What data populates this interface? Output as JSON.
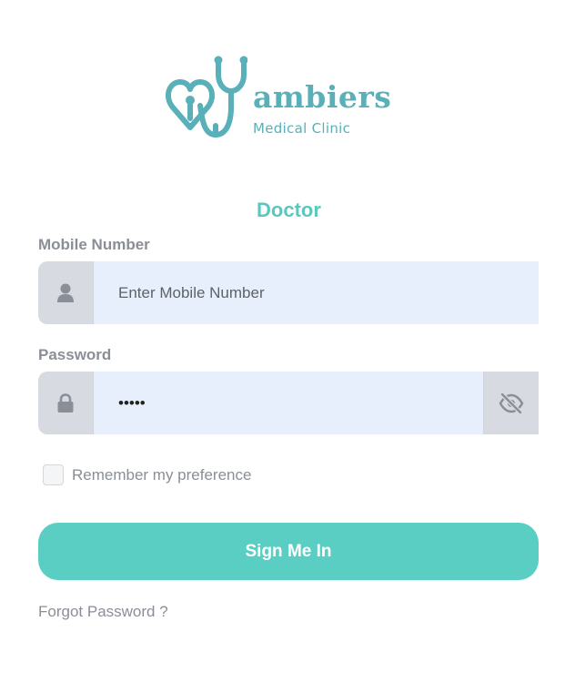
{
  "brand": {
    "name": "ambiers",
    "subtitle": "Medical Clinic",
    "color": "#5ab0b8"
  },
  "role_title": "Doctor",
  "mobile": {
    "label": "Mobile Number",
    "placeholder": "Enter Mobile Number",
    "value": "",
    "icon": "user-icon"
  },
  "password": {
    "label": "Password",
    "value": "•••••",
    "icon": "lock-icon",
    "toggle_icon": "eye-slash-icon"
  },
  "remember": {
    "label": "Remember my preference",
    "checked": false
  },
  "signin_label": "Sign Me In",
  "forgot_label": "Forgot Password ?",
  "colors": {
    "accent": "#5bcec3",
    "input_bg": "#e8effc",
    "addon_bg": "#d7dae1",
    "label_text": "#8a8e96"
  }
}
